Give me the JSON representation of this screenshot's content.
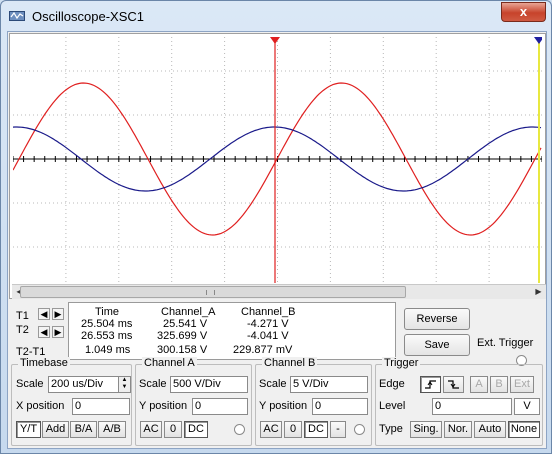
{
  "window": {
    "title": "Oscilloscope-XSC1",
    "close_label": "x",
    "accent": "#c7432b"
  },
  "scope": {
    "background": "#ffffff",
    "channel_a_color": "#e02020",
    "channel_b_color": "#1a1a8a",
    "t1_color": "#e02020",
    "t2_color": "#2020a0",
    "t2_line_color": "#e8e840"
  },
  "readout": {
    "t1_label": "T1",
    "t2_label": "T2",
    "t2t1_label": "T2-T1",
    "headers": [
      "Time",
      "Channel_A",
      "Channel_B"
    ],
    "rows": [
      [
        "25.504 ms",
        "25.541 V",
        "-4.271 V"
      ],
      [
        "26.553 ms",
        "325.699 V",
        "-4.041 V"
      ],
      [
        "1.049 ms",
        "300.158 V",
        "229.877 mV"
      ]
    ]
  },
  "buttons": {
    "reverse": "Reverse",
    "save": "Save",
    "ext_trigger": "Ext. Trigger"
  },
  "timebase": {
    "title": "Timebase",
    "scale_label": "Scale",
    "scale_value": "200 us/Div",
    "xpos_label": "X position",
    "xpos_value": "0",
    "modes": [
      "Y/T",
      "Add",
      "B/A",
      "A/B"
    ]
  },
  "channel_a": {
    "title": "Channel A",
    "scale_label": "Scale",
    "scale_value": "500  V/Div",
    "ypos_label": "Y position",
    "ypos_value": "0",
    "coupling": [
      "AC",
      "0",
      "DC"
    ]
  },
  "channel_b": {
    "title": "Channel B",
    "scale_label": "Scale",
    "scale_value": "5  V/Div",
    "ypos_label": "Y position",
    "ypos_value": "0",
    "coupling": [
      "AC",
      "0",
      "DC",
      "-"
    ]
  },
  "trigger": {
    "title": "Trigger",
    "edge_label": "Edge",
    "edge_buttons": [
      "A",
      "B",
      "Ext"
    ],
    "level_label": "Level",
    "level_value": "0",
    "level_unit": "V",
    "type_label": "Type",
    "types": [
      "Sing.",
      "Nor.",
      "Auto",
      "None"
    ]
  }
}
